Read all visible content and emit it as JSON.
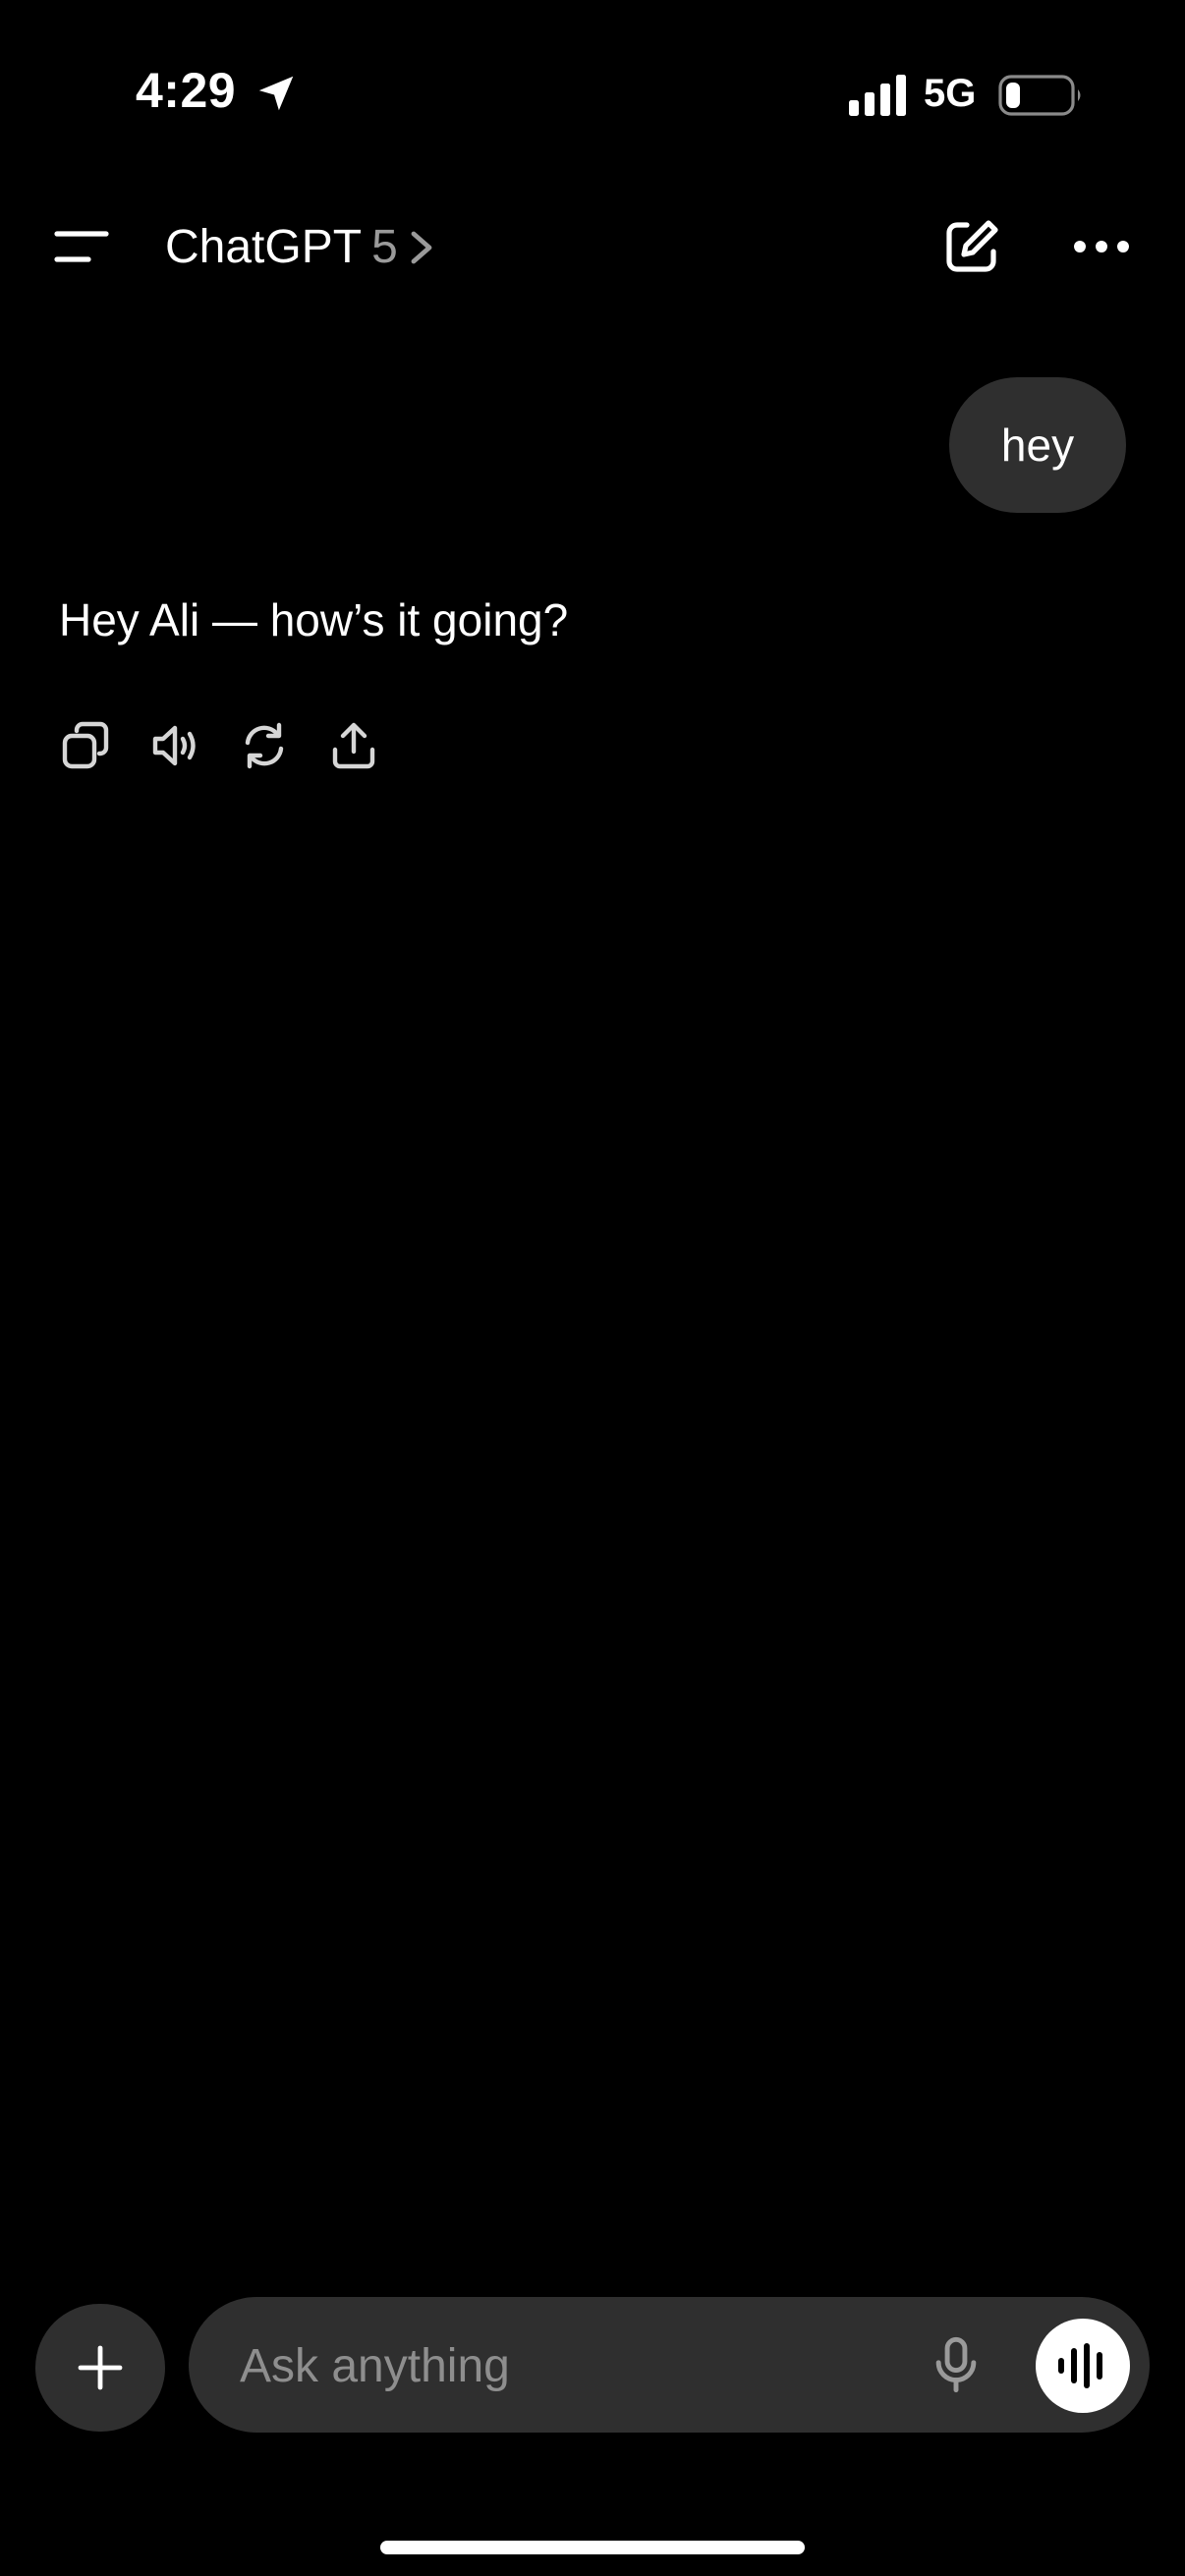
{
  "status_bar": {
    "time": "4:29",
    "network": "5G",
    "icons": [
      "location-arrow-icon",
      "signal-icon",
      "battery-icon"
    ]
  },
  "header": {
    "title": "ChatGPT",
    "version": "5",
    "icons": [
      "menu-icon",
      "chevron-right-icon",
      "compose-icon",
      "more-icon"
    ]
  },
  "conversation": {
    "user_message": "hey",
    "assistant_message": "Hey Ali — how’s it going?",
    "actions": [
      "copy-icon",
      "speaker-icon",
      "regenerate-icon",
      "share-icon"
    ]
  },
  "composer": {
    "placeholder": "Ask anything",
    "value": "",
    "icons": [
      "plus-icon",
      "microphone-icon",
      "voice-mode-icon"
    ]
  },
  "colors": {
    "background": "#000000",
    "bubble": "#2f2f2f",
    "text": "#ffffff",
    "muted_text": "#9a9a9a",
    "placeholder": "#8e8e8e"
  }
}
